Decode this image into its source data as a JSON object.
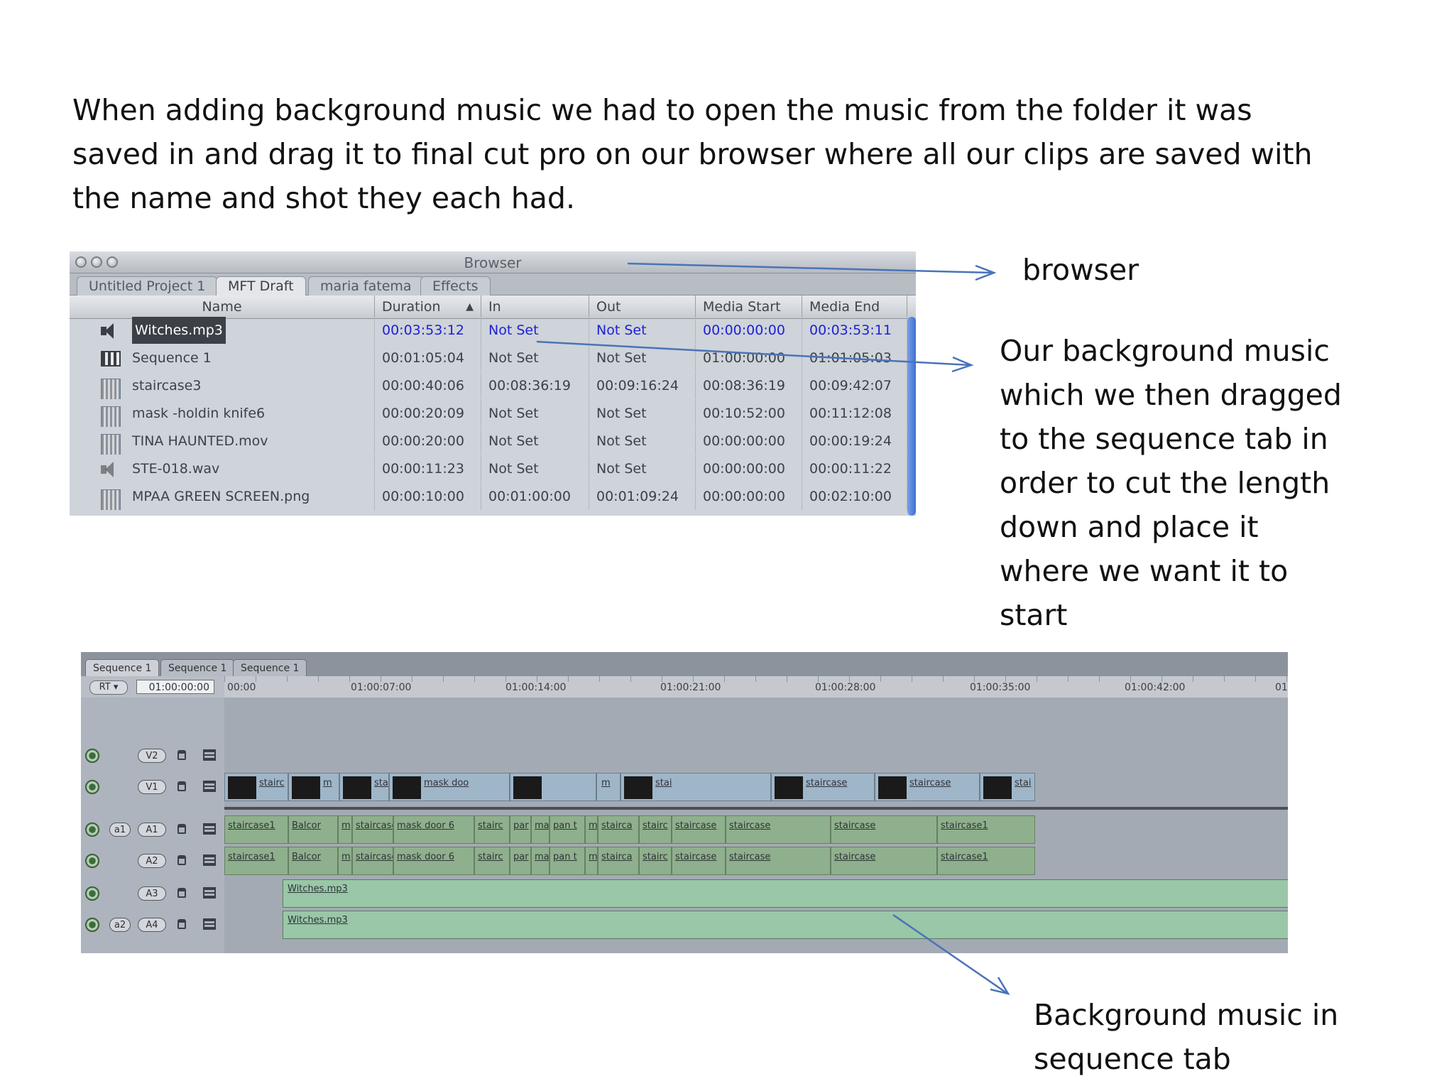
{
  "intro": {
    "line1": "When adding background music we had to open the music  from the folder it was",
    "line2": "saved in and drag it to final cut pro on our browser where all our clips are saved with",
    "line3": "the name and shot they each had."
  },
  "annotations": {
    "browser": "browser",
    "music": [
      "Our background music",
      "which we then dragged",
      "to the sequence tab in",
      "order to cut the length",
      "down and place it",
      "where we want it to",
      "start"
    ],
    "sequence": [
      "Background music in",
      "sequence tab"
    ]
  },
  "browser_window": {
    "title": "Browser",
    "tabs": [
      "Untitled Project 1",
      "MFT Draft",
      "maria fatema",
      "Effects"
    ],
    "active_tab": "MFT Draft",
    "columns": [
      "Name",
      "Duration",
      "In",
      "Out",
      "Media Start",
      "Media End"
    ],
    "sort_indicator": "▲",
    "rows": [
      {
        "icon": "speaker-icon",
        "name": "Witches.mp3",
        "duration": "00:03:53:12",
        "in": "Not Set",
        "out": "Not Set",
        "media_start": "00:00:00:00",
        "media_end": "00:03:53:11"
      },
      {
        "icon": "sequence-icon",
        "name": "Sequence 1",
        "duration": "00:01:05:04",
        "in": "Not Set",
        "out": "Not Set",
        "media_start": "01:00:00:00",
        "media_end": "01:01:05:03"
      },
      {
        "icon": "clip-icon",
        "name": "staircase3",
        "duration": "00:00:40:06",
        "in": "00:08:36:19",
        "out": "00:09:16:24",
        "media_start": "00:08:36:19",
        "media_end": "00:09:42:07"
      },
      {
        "icon": "clip-icon",
        "name": "mask -holdin knife6",
        "duration": "00:00:20:09",
        "in": "Not Set",
        "out": "Not Set",
        "media_start": "00:10:52:00",
        "media_end": "00:11:12:08"
      },
      {
        "icon": "clip-icon",
        "name": "TINA HAUNTED.mov",
        "duration": "00:00:20:00",
        "in": "Not Set",
        "out": "Not Set",
        "media_start": "00:00:00:00",
        "media_end": "00:00:19:24"
      },
      {
        "icon": "speaker-icon",
        "name": "STE-018.wav",
        "duration": "00:00:11:23",
        "in": "Not Set",
        "out": "Not Set",
        "media_start": "00:00:00:00",
        "media_end": "00:00:11:22"
      },
      {
        "icon": "graphic-icon",
        "name": "MPAA GREEN SCREEN.png",
        "duration": "00:00:10:00",
        "in": "00:01:00:00",
        "out": "00:01:09:24",
        "media_start": "00:00:00:00",
        "media_end": "00:02:10:00"
      }
    ]
  },
  "timeline": {
    "tabs": [
      "Sequence 1",
      "Sequence 1",
      "Sequence 1"
    ],
    "rt": "RT ▾",
    "timecode": "01:00:00:00",
    "ruler": [
      "00:00",
      "01:00:07:00",
      "01:00:14:00",
      "01:00:21:00",
      "01:00:28:00",
      "01:00:35:00",
      "01:00:42:00",
      "01"
    ],
    "tracks": [
      {
        "id": "v2",
        "label": "V2"
      },
      {
        "id": "v1",
        "label": "V1"
      },
      {
        "id": "a1",
        "label": "A1",
        "source": "a1"
      },
      {
        "id": "a2",
        "label": "A2"
      },
      {
        "id": "a3",
        "label": "A3"
      },
      {
        "id": "a4",
        "label": "A4",
        "source": "a2"
      }
    ],
    "v1_clips": [
      "stairc",
      "m",
      "sta",
      "mask doo",
      "m",
      "stai",
      "staircase",
      "staircase",
      "stai"
    ],
    "a1_clips": [
      "staircase1",
      "Balcor",
      "m",
      "staircase",
      "mask door 6",
      "stairc",
      "par",
      "mas",
      "pan t",
      "m",
      "stairca",
      "stairc",
      "staircase",
      "staircase",
      "staircase",
      "staircase1"
    ],
    "a2_clips": [
      "staircase1",
      "Balcor",
      "m",
      "staircase",
      "mask door 6",
      "stairc",
      "par",
      "mas",
      "pan t",
      "m",
      "stairca",
      "stairc",
      "staircase",
      "staircase",
      "staircase",
      "staircase1"
    ],
    "music_clip": "Witches.mp3"
  },
  "colors": {
    "timecode_blue": "#1d22d6",
    "arrow": "#4a73b8",
    "video_clip": "#9fb6c9",
    "audio_clip": "#8fb08c",
    "music_clip": "#99c7a8"
  }
}
